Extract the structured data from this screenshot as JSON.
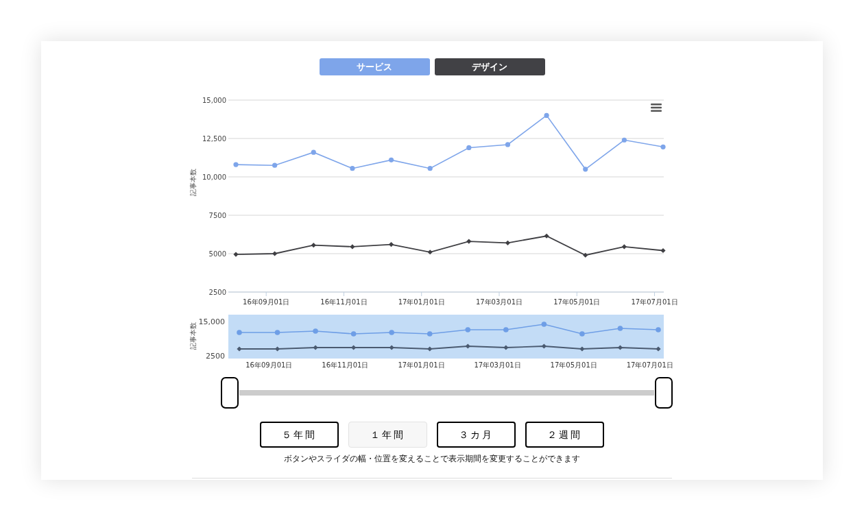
{
  "tabs": [
    {
      "label": "サービス",
      "selected": true
    },
    {
      "label": "デザイン",
      "selected": false
    }
  ],
  "main_chart": {
    "chart_data": {
      "type": "line",
      "ylabel": "記事本数",
      "categories": [
        null,
        "16年09月01日",
        null,
        "16年11月01日",
        null,
        "17年01月01日",
        null,
        "17年03月01日",
        null,
        "17年05月01日",
        null,
        "17年07月01日"
      ],
      "grid": true,
      "series": [
        {
          "color": "#7ea5ea",
          "marker": "circle",
          "values": [
            10800,
            10750,
            11600,
            10550,
            11100,
            10550,
            11900,
            12100,
            14000,
            10500,
            12400,
            11950
          ]
        },
        {
          "color": "#3f3f43",
          "marker": "diamond",
          "values": [
            4950,
            5000,
            5550,
            5450,
            5600,
            5100,
            5800,
            5700,
            6150,
            4900,
            5450,
            5200
          ]
        }
      ],
      "ylim": [
        2500,
        15000
      ],
      "yticks": [
        {
          "value": 2500,
          "label": "2500"
        },
        {
          "value": 5000,
          "label": "5000"
        },
        {
          "value": 7500,
          "label": "7500"
        },
        {
          "value": 10000,
          "label": "10,000"
        },
        {
          "value": 12500,
          "label": "12,500"
        },
        {
          "value": 15000,
          "label": "15,000"
        }
      ]
    }
  },
  "navigator_chart": {
    "chart_data": {
      "type": "line",
      "ylabel": "記事本数",
      "categories": [
        null,
        "16年09月01日",
        null,
        "16年11月01日",
        null,
        "17年01月01日",
        null,
        "17年03月01日",
        null,
        "17年05月01日",
        null,
        "17年07月01日"
      ],
      "series": [
        {
          "color": "#6e9ee6",
          "marker": "circle",
          "values": [
            11000,
            11000,
            11500,
            10500,
            11000,
            10500,
            12000,
            12000,
            14000,
            10500,
            12500,
            12000
          ]
        },
        {
          "color": "#4a5a70",
          "marker": "diamond",
          "values": [
            5000,
            5000,
            5500,
            5500,
            5500,
            5000,
            6000,
            5500,
            6000,
            5000,
            5500,
            5000
          ]
        }
      ],
      "ylim": [
        1500,
        17500
      ],
      "yticks": [
        {
          "value": 2500,
          "label": "2500"
        },
        {
          "value": 15000,
          "label": "15,000"
        }
      ]
    }
  },
  "slider": {
    "handles": [
      {
        "level": 0
      },
      {
        "level": 1
      }
    ]
  },
  "range_buttons": [
    {
      "label": "５年間",
      "selected": false
    },
    {
      "label": "１年間",
      "selected": true
    },
    {
      "label": "３カ月",
      "selected": false
    },
    {
      "label": "２週間",
      "selected": false
    }
  ],
  "hint": "ボタンやスライダの幅・位置を変えることで表示期間を変更することができます"
}
